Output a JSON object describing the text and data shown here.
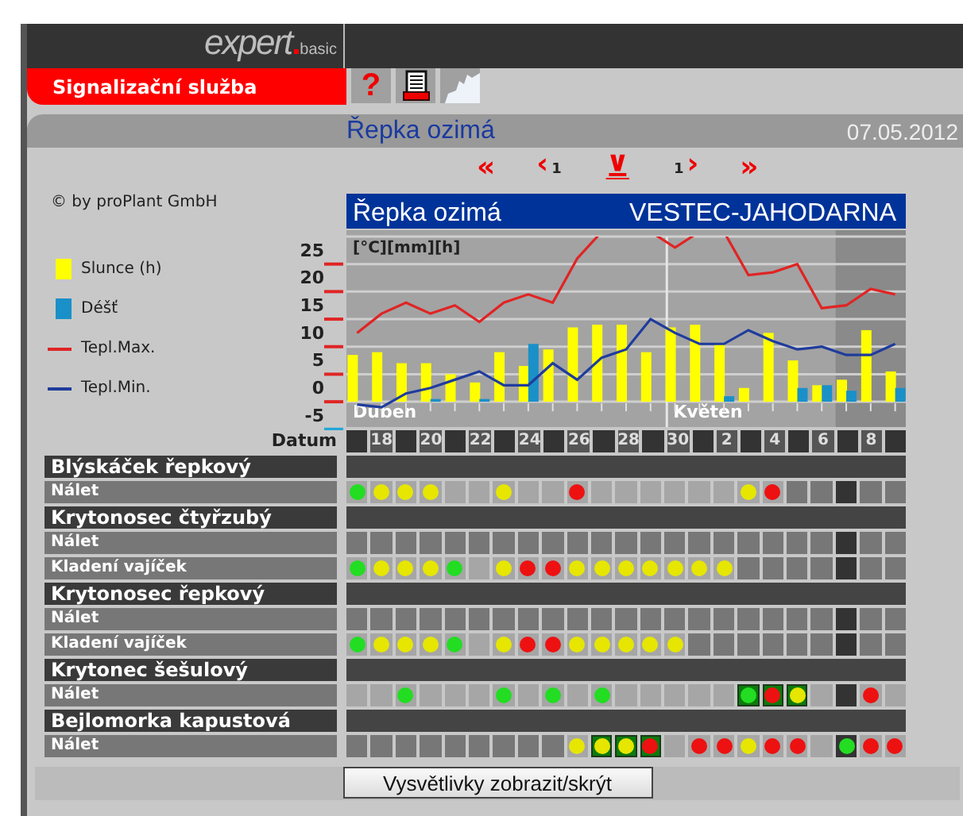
{
  "logo": {
    "name": "expert",
    "edition": "basic"
  },
  "module_tab": {
    "label": "Signalizační služba",
    "selected": true
  },
  "toolbar": [
    {
      "kind": "help",
      "glyph": "?"
    },
    {
      "kind": "print"
    },
    {
      "kind": "map"
    }
  ],
  "title_bar": {
    "title": "Řepka ozimá",
    "date": "07.05.2012"
  },
  "navigation": [
    {
      "kind": "first",
      "glyph": "«"
    },
    {
      "kind": "prev",
      "glyph": "‹",
      "step": "1"
    },
    {
      "kind": "today",
      "glyph": "⊻"
    },
    {
      "kind": "next",
      "glyph": "›",
      "step": "1"
    },
    {
      "kind": "last",
      "glyph": "»"
    }
  ],
  "copyright": "© by proPlant GmbH",
  "chart": {
    "crop": "Řepka ozimá",
    "station": "VESTEC-JAHODARNA",
    "chart_data": {
      "type": "bar",
      "ylabel": "[°C][mm][h]",
      "ylim": [
        -5,
        30
      ],
      "yticks": [
        -5,
        0,
        5,
        10,
        15,
        20,
        25
      ],
      "grid": true,
      "series": [
        {
          "name": "Slunce (h)",
          "type": "bar",
          "color": "#ffff00",
          "values": [
            8.5,
            9,
            7,
            7,
            5,
            3.5,
            9,
            6.5,
            9.5,
            13.5,
            14,
            14,
            9,
            13.5,
            14,
            10.5,
            2.5,
            12.5,
            7.5,
            3,
            4,
            13,
            5.5
          ]
        },
        {
          "name": "Déšť",
          "type": "bar",
          "color": "#1a90c8",
          "values": [
            0,
            0,
            0,
            0.5,
            0,
            0.5,
            0,
            10.5,
            0,
            0,
            0,
            0,
            0,
            0,
            0,
            1,
            0,
            0,
            2.5,
            3,
            2,
            0,
            2.5
          ]
        },
        {
          "name": "Tepl.Max.",
          "type": "line",
          "color": "#e02424",
          "values": [
            12.5,
            16,
            18,
            16,
            17.5,
            14.5,
            18,
            19.5,
            18,
            26,
            null,
            null,
            null,
            28,
            null,
            null,
            23,
            23.5,
            25,
            17,
            17.5,
            20.5,
            19.5
          ]
        },
        {
          "name": "Tepl.Min.",
          "type": "line",
          "color": "#1f3c9c",
          "values": [
            -0.5,
            -1,
            1.5,
            2.5,
            4,
            5.5,
            3,
            3,
            7,
            4,
            8,
            9.5,
            15,
            12.5,
            10.5,
            10.5,
            13,
            11,
            9.5,
            10,
            8.5,
            8.5,
            10.5
          ]
        }
      ],
      "annotations": [
        "Duben",
        "Květen"
      ]
    }
  },
  "date_row": {
    "label": "Datum",
    "columns": [
      {
        "kind": "blank"
      },
      {
        "kind": "labeled",
        "label": "18"
      },
      {
        "kind": "blank"
      },
      {
        "kind": "labeled",
        "label": "20"
      },
      {
        "kind": "blank"
      },
      {
        "kind": "labeled",
        "label": "22"
      },
      {
        "kind": "blank"
      },
      {
        "kind": "labeled",
        "label": "24"
      },
      {
        "kind": "blank"
      },
      {
        "kind": "labeled",
        "label": "26"
      },
      {
        "kind": "blank"
      },
      {
        "kind": "labeled",
        "label": "28"
      },
      {
        "kind": "blank"
      },
      {
        "kind": "labeled",
        "label": "30"
      },
      {
        "kind": "blank"
      },
      {
        "kind": "labeled",
        "label": "2"
      },
      {
        "kind": "blank"
      },
      {
        "kind": "labeled",
        "label": "4"
      },
      {
        "kind": "blank"
      },
      {
        "kind": "labeled",
        "label": "6"
      },
      {
        "kind": "blank"
      },
      {
        "kind": "labeled",
        "label": "8"
      },
      {
        "kind": "blank"
      }
    ]
  },
  "pests": [
    {
      "name": "Blýskáček řepkový",
      "rows": [
        {
          "label": "Nálet",
          "cells": [
            {
              "kind": "light",
              "color": "#22dd22"
            },
            {
              "kind": "light",
              "color": "#e6e600"
            },
            {
              "kind": "light",
              "color": "#e6e600"
            },
            {
              "kind": "light",
              "color": "#e6e600"
            },
            {
              "kind": "light"
            },
            {
              "kind": "light"
            },
            {
              "kind": "light",
              "color": "#e6e600"
            },
            {
              "kind": "light"
            },
            {
              "kind": "light"
            },
            {
              "kind": "light",
              "color": "#ee1111"
            },
            {
              "kind": "light"
            },
            {
              "kind": "light"
            },
            {
              "kind": "light"
            },
            {
              "kind": "light"
            },
            {
              "kind": "light"
            },
            {
              "kind": "light"
            },
            {
              "kind": "light",
              "color": "#e6e600"
            },
            {
              "kind": "light",
              "color": "#ee1111"
            },
            {
              "kind": "dark"
            },
            {
              "kind": "dark"
            },
            {
              "kind": "today"
            },
            {
              "kind": "dark"
            },
            {
              "kind": "dark"
            }
          ]
        }
      ]
    },
    {
      "name": "Krytonosec čtyřzubý",
      "rows": [
        {
          "label": "Nálet",
          "cells": [
            {
              "kind": "dark"
            },
            {
              "kind": "dark"
            },
            {
              "kind": "dark"
            },
            {
              "kind": "dark"
            },
            {
              "kind": "dark"
            },
            {
              "kind": "dark"
            },
            {
              "kind": "dark"
            },
            {
              "kind": "dark"
            },
            {
              "kind": "dark"
            },
            {
              "kind": "dark"
            },
            {
              "kind": "dark"
            },
            {
              "kind": "dark"
            },
            {
              "kind": "dark"
            },
            {
              "kind": "dark"
            },
            {
              "kind": "dark"
            },
            {
              "kind": "dark"
            },
            {
              "kind": "dark"
            },
            {
              "kind": "dark"
            },
            {
              "kind": "dark"
            },
            {
              "kind": "dark"
            },
            {
              "kind": "today"
            },
            {
              "kind": "dark"
            },
            {
              "kind": "dark"
            }
          ]
        },
        {
          "label": "Kladení vajíček",
          "cells": [
            {
              "kind": "light",
              "color": "#22dd22"
            },
            {
              "kind": "light",
              "color": "#e6e600"
            },
            {
              "kind": "light",
              "color": "#e6e600"
            },
            {
              "kind": "light",
              "color": "#e6e600"
            },
            {
              "kind": "light",
              "color": "#22dd22"
            },
            {
              "kind": "light"
            },
            {
              "kind": "light",
              "color": "#e6e600"
            },
            {
              "kind": "light",
              "color": "#ee1111"
            },
            {
              "kind": "light",
              "color": "#ee1111"
            },
            {
              "kind": "light",
              "color": "#e6e600"
            },
            {
              "kind": "light",
              "color": "#e6e600"
            },
            {
              "kind": "light",
              "color": "#e6e600"
            },
            {
              "kind": "light",
              "color": "#e6e600"
            },
            {
              "kind": "light",
              "color": "#e6e600"
            },
            {
              "kind": "light",
              "color": "#e6e600"
            },
            {
              "kind": "light",
              "color": "#e6e600"
            },
            {
              "kind": "dark"
            },
            {
              "kind": "dark"
            },
            {
              "kind": "dark"
            },
            {
              "kind": "dark"
            },
            {
              "kind": "today"
            },
            {
              "kind": "dark"
            },
            {
              "kind": "dark"
            }
          ]
        }
      ]
    },
    {
      "name": "Krytonosec řepkový",
      "rows": [
        {
          "label": "Nálet",
          "cells": [
            {
              "kind": "dark"
            },
            {
              "kind": "dark"
            },
            {
              "kind": "dark"
            },
            {
              "kind": "dark"
            },
            {
              "kind": "dark"
            },
            {
              "kind": "dark"
            },
            {
              "kind": "dark"
            },
            {
              "kind": "dark"
            },
            {
              "kind": "dark"
            },
            {
              "kind": "dark"
            },
            {
              "kind": "dark"
            },
            {
              "kind": "dark"
            },
            {
              "kind": "dark"
            },
            {
              "kind": "dark"
            },
            {
              "kind": "dark"
            },
            {
              "kind": "dark"
            },
            {
              "kind": "dark"
            },
            {
              "kind": "dark"
            },
            {
              "kind": "dark"
            },
            {
              "kind": "dark"
            },
            {
              "kind": "today"
            },
            {
              "kind": "dark"
            },
            {
              "kind": "dark"
            }
          ]
        },
        {
          "label": "Kladení vajíček",
          "cells": [
            {
              "kind": "light",
              "color": "#22dd22"
            },
            {
              "kind": "light",
              "color": "#e6e600"
            },
            {
              "kind": "light",
              "color": "#e6e600"
            },
            {
              "kind": "light",
              "color": "#e6e600"
            },
            {
              "kind": "light",
              "color": "#22dd22"
            },
            {
              "kind": "light"
            },
            {
              "kind": "light",
              "color": "#e6e600"
            },
            {
              "kind": "light",
              "color": "#ee1111"
            },
            {
              "kind": "light",
              "color": "#ee1111"
            },
            {
              "kind": "light",
              "color": "#e6e600"
            },
            {
              "kind": "light",
              "color": "#e6e600"
            },
            {
              "kind": "light",
              "color": "#e6e600"
            },
            {
              "kind": "light",
              "color": "#e6e600"
            },
            {
              "kind": "light",
              "color": "#e6e600"
            },
            {
              "kind": "dark"
            },
            {
              "kind": "dark"
            },
            {
              "kind": "dark"
            },
            {
              "kind": "dark"
            },
            {
              "kind": "dark"
            },
            {
              "kind": "dark"
            },
            {
              "kind": "today"
            },
            {
              "kind": "dark"
            },
            {
              "kind": "dark"
            }
          ]
        }
      ]
    },
    {
      "name": "Krytonec šešulový",
      "rows": [
        {
          "label": "Nálet",
          "cells": [
            {
              "kind": "light"
            },
            {
              "kind": "light"
            },
            {
              "kind": "light",
              "color": "#22dd22"
            },
            {
              "kind": "light"
            },
            {
              "kind": "light"
            },
            {
              "kind": "light"
            },
            {
              "kind": "light",
              "color": "#22dd22"
            },
            {
              "kind": "light"
            },
            {
              "kind": "light",
              "color": "#22dd22"
            },
            {
              "kind": "light"
            },
            {
              "kind": "light",
              "color": "#22dd22"
            },
            {
              "kind": "light"
            },
            {
              "kind": "light"
            },
            {
              "kind": "light"
            },
            {
              "kind": "light"
            },
            {
              "kind": "light"
            },
            {
              "kind": "framed",
              "color": "#22dd22"
            },
            {
              "kind": "framed",
              "color": "#ee1111"
            },
            {
              "kind": "framed",
              "color": "#e6e600"
            },
            {
              "kind": "light"
            },
            {
              "kind": "today"
            },
            {
              "kind": "light",
              "color": "#ee1111"
            },
            {
              "kind": "light"
            }
          ]
        }
      ]
    },
    {
      "name": "Bejlomorka kapustová",
      "rows": [
        {
          "label": "Nálet",
          "cells": [
            {
              "kind": "dark"
            },
            {
              "kind": "dark"
            },
            {
              "kind": "dark"
            },
            {
              "kind": "dark"
            },
            {
              "kind": "dark"
            },
            {
              "kind": "dark"
            },
            {
              "kind": "dark"
            },
            {
              "kind": "dark"
            },
            {
              "kind": "dark"
            },
            {
              "kind": "light",
              "color": "#e6e600"
            },
            {
              "kind": "framed",
              "color": "#e6e600"
            },
            {
              "kind": "framed",
              "color": "#e6e600"
            },
            {
              "kind": "framed",
              "color": "#ee1111"
            },
            {
              "kind": "light"
            },
            {
              "kind": "light",
              "color": "#ee1111"
            },
            {
              "kind": "light",
              "color": "#ee1111"
            },
            {
              "kind": "light",
              "color": "#e6e600"
            },
            {
              "kind": "light",
              "color": "#ee1111"
            },
            {
              "kind": "light",
              "color": "#ee1111"
            },
            {
              "kind": "light"
            },
            {
              "kind": "today",
              "color": "#22dd22"
            },
            {
              "kind": "light",
              "color": "#ee1111"
            },
            {
              "kind": "light",
              "color": "#ee1111"
            }
          ]
        }
      ]
    }
  ],
  "legend_button": {
    "label": "Vysvětlivky zobrazit/skrýt"
  }
}
